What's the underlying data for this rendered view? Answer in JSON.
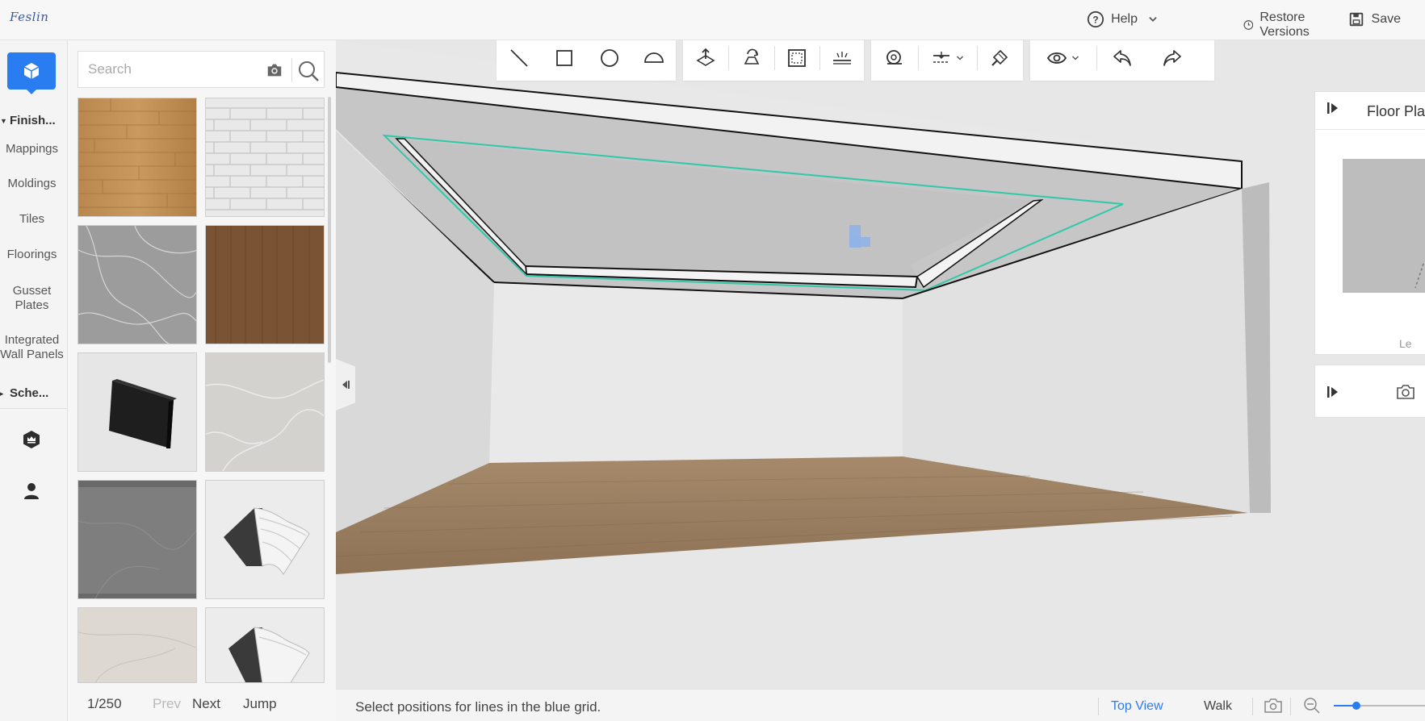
{
  "app": {
    "logo": "Feslin"
  },
  "header": {
    "help_label": "Help",
    "restore_label": "Restore Versions",
    "save_label": "Save"
  },
  "rail": {
    "groups": [
      {
        "label": "Finish..."
      },
      {
        "label": "Sche..."
      }
    ],
    "items": [
      {
        "label": "Mappings"
      },
      {
        "label": "Moldings"
      },
      {
        "label": "Tiles"
      },
      {
        "label": "Floorings"
      },
      {
        "label": "Gusset\nPlates"
      },
      {
        "label": "Integrated\nWall Panels"
      }
    ],
    "accent_color": "#2a7df0"
  },
  "search": {
    "placeholder": "Search"
  },
  "materials": [
    {
      "name": "light wood planks"
    },
    {
      "name": "white brick"
    },
    {
      "name": "grey marble"
    },
    {
      "name": "walnut wood"
    },
    {
      "name": "black panel"
    },
    {
      "name": "light grey marble"
    },
    {
      "name": "dark grey stone"
    },
    {
      "name": "crown molding"
    },
    {
      "name": "beige marble"
    },
    {
      "name": "crown molding 2"
    }
  ],
  "pager": {
    "page": "1/250",
    "prev": "Prev",
    "next": "Next",
    "jump": "Jump"
  },
  "toolbar": {
    "groups": [
      [
        "line-icon",
        "rectangle-icon",
        "circle-icon",
        "arc-icon"
      ],
      [
        "move-up-icon",
        "rotate-icon",
        "select-area-icon",
        "light-icon"
      ],
      [
        "tape-measure-icon",
        "align-icon",
        "paint-brush-icon"
      ],
      [
        "eye-icon",
        "undo-icon",
        "redo-icon"
      ]
    ]
  },
  "right_panel": {
    "title": "Floor Plan",
    "footer_label": "Le"
  },
  "status": {
    "message": "Select positions for lines in the blue grid.",
    "top_view": "Top View",
    "walk": "Walk",
    "link_color": "#2a7df0",
    "selection_color": "#2fc9a8"
  }
}
